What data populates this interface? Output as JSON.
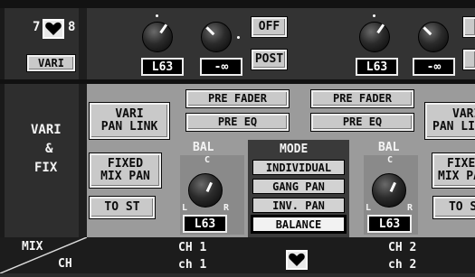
{
  "vari": {
    "num_left": "7",
    "num_right": "8",
    "button": "VARI"
  },
  "top": {
    "ch1": {
      "knob1_value": "L63",
      "knob2_value": "-∞",
      "off_label": "OFF",
      "post_label": "POST"
    },
    "ch2": {
      "knob1_value": "L63",
      "knob2_value": "-∞"
    }
  },
  "side": {
    "line1": "VARI",
    "line2": "&",
    "line3": "FIX"
  },
  "ch1": {
    "vari_pan_link": [
      "VARI",
      "PAN LINK"
    ],
    "pre_fader": "PRE FADER",
    "pre_eq": "PRE EQ",
    "fixed_mix_pan": [
      "FIXED",
      "MIX PAN"
    ],
    "to_st": "TO ST",
    "bal_label": "BAL",
    "bal_c": "C",
    "bal_l": "L",
    "bal_r": "R",
    "bal_value": "L63"
  },
  "mode": {
    "title": "MODE",
    "items": [
      "INDIVIDUAL",
      "GANG PAN",
      "INV. PAN",
      "BALANCE"
    ],
    "selected": 3
  },
  "ch2": {
    "pre_fader": "PRE FADER",
    "pre_eq": "PRE EQ",
    "vari_pan_link": [
      "VARI",
      "PAN LINK"
    ],
    "fixed_mix_pan": [
      "FIXED",
      "MIX PAN"
    ],
    "to_st": "TO ST",
    "bal_label": "BAL",
    "bal_c": "C",
    "bal_l": "L",
    "bal_r": "R",
    "bal_value": "L63"
  },
  "footer": {
    "mix_label": "MIX",
    "ch_label": "CH",
    "ch1_line1": "CH 1",
    "ch1_line2": "ch 1",
    "ch2_line1": "CH 2",
    "ch2_line2": "ch 2"
  }
}
